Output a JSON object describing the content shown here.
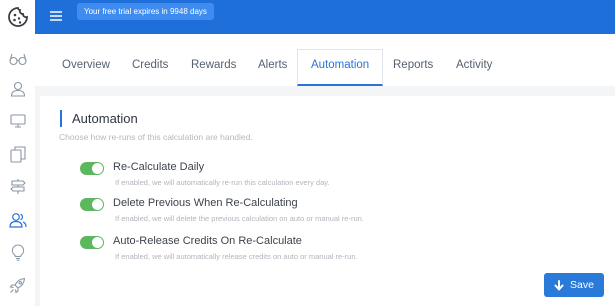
{
  "topbar": {
    "trial_text": "Your free trial expires in 9948 days"
  },
  "sidebar": {
    "logo_icon": "cookie-logo-icon",
    "icons": [
      "glasses-icon",
      "user-icon",
      "monitor-icon",
      "documents-icon",
      "signpost-icon",
      "users-icon",
      "lightbulb-icon",
      "rocket-icon"
    ],
    "active_color": "#2a74d8"
  },
  "tabs": [
    {
      "label": "Overview"
    },
    {
      "label": "Credits"
    },
    {
      "label": "Rewards"
    },
    {
      "label": "Alerts"
    },
    {
      "label": "Automation",
      "active": true
    },
    {
      "label": "Reports"
    },
    {
      "label": "Activity"
    }
  ],
  "section": {
    "title": "Automation",
    "subtitle": "Choose how re-runs of this calculation are handled."
  },
  "options": [
    {
      "label": "Re-Calculate Daily",
      "help": "If enabled, we will automatically re-run this calculation every day.",
      "enabled": true
    },
    {
      "label": "Delete Previous When Re-Calculating",
      "help": "If enabled, we will delete the previous calculation on auto or manual re-run.",
      "enabled": true
    },
    {
      "label": "Auto-Release Credits On Re-Calculate",
      "help": "If enabled, we will automatically release credits on auto or manual re-run.",
      "enabled": true
    }
  ],
  "save_label": "Save",
  "colors": {
    "brand": "#1e6fd9",
    "toggle_on": "#5cb85c",
    "accent": "#2a74d8"
  }
}
